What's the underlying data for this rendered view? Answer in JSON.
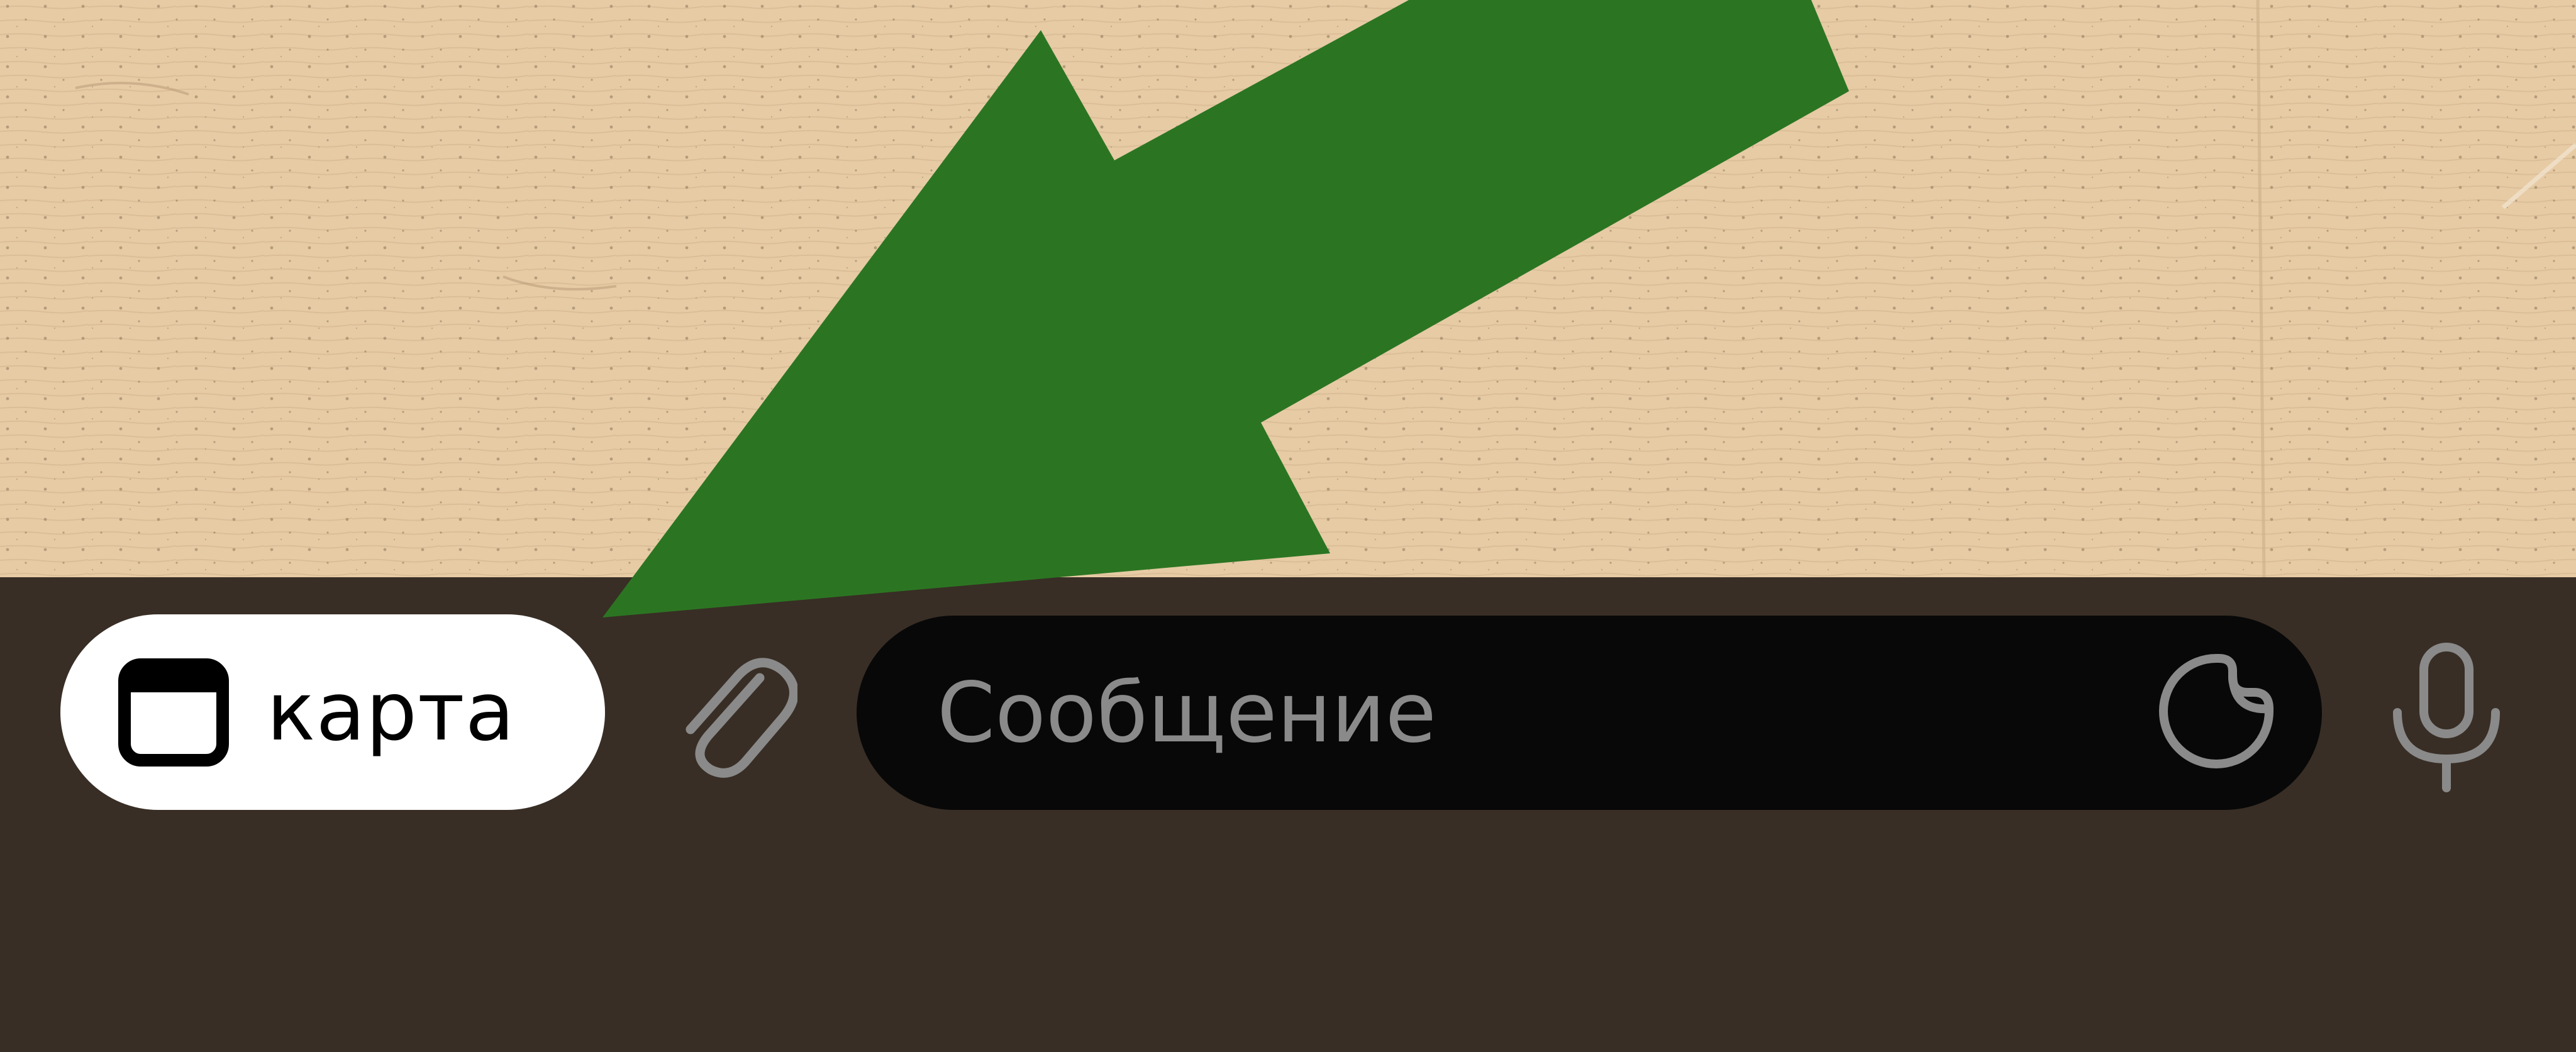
{
  "colors": {
    "wallpaper": "#e6cba5",
    "input_bar": "#382e25",
    "menu_button_bg": "#ffffff",
    "message_field_bg": "#080808",
    "icon_gray": "#8a8a8a",
    "annotation_arrow": "#2b7522"
  },
  "composer": {
    "menu_button": {
      "label": "карта",
      "icon": "window-icon"
    },
    "attach_icon": "paperclip-icon",
    "message_field": {
      "placeholder": "Сообщение",
      "value": ""
    },
    "sticker_icon": "sticker-icon",
    "mic_icon": "microphone-icon"
  },
  "annotation": {
    "type": "arrow",
    "points_to": "menu_button"
  }
}
